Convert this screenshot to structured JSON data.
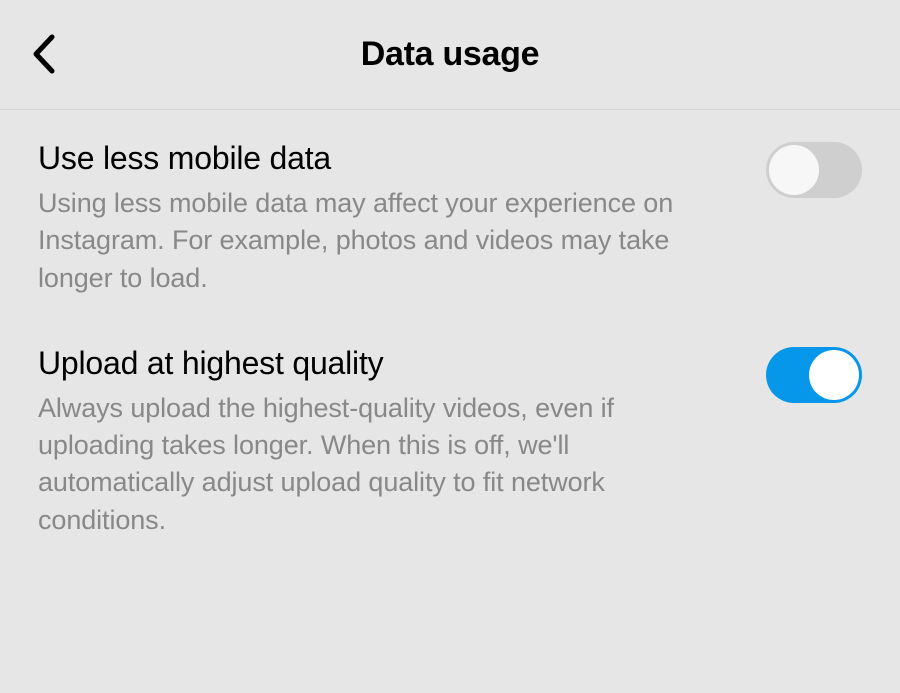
{
  "header": {
    "title": "Data usage"
  },
  "settings": [
    {
      "title": "Use less mobile data",
      "description": "Using less mobile data may affect your experience on Instagram. For example, photos and videos may take longer to load.",
      "enabled": false
    },
    {
      "title": "Upload at highest quality",
      "description": "Always upload the highest-quality videos, even if uploading takes longer. When this is off, we'll automatically adjust upload quality to fit network conditions.",
      "enabled": true
    }
  ]
}
